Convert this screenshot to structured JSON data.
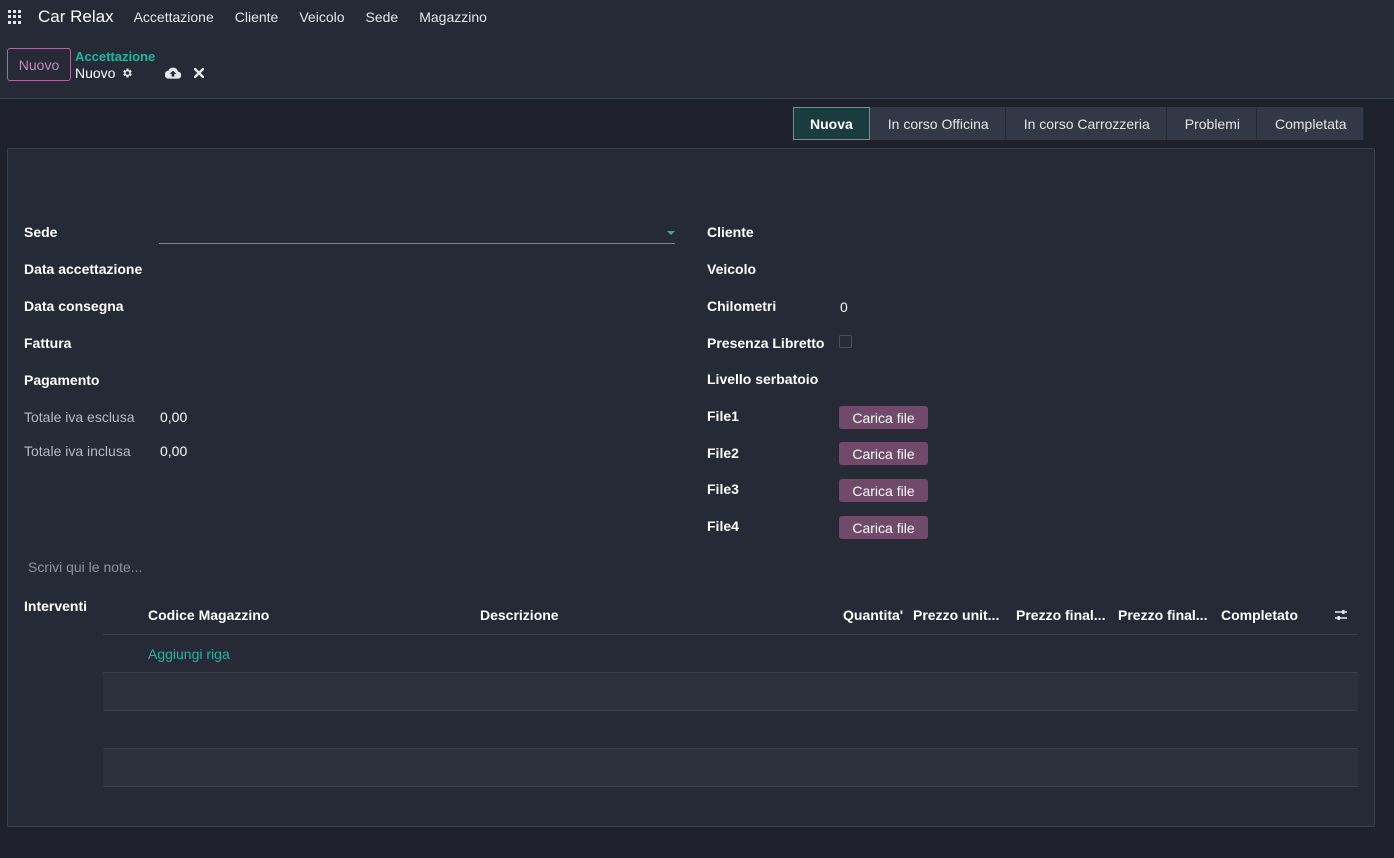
{
  "navbar": {
    "brand": "Car Relax",
    "menu": [
      "Accettazione",
      "Cliente",
      "Veicolo",
      "Sede",
      "Magazzino"
    ]
  },
  "control": {
    "new_button": "Nuovo",
    "breadcrumb_parent": "Accettazione",
    "breadcrumb_current": "Nuovo"
  },
  "statusbar": {
    "stages": [
      "Nuova",
      "In corso Officina",
      "In corso Carrozzeria",
      "Problemi",
      "Completata"
    ],
    "active": "Nuova"
  },
  "form": {
    "left": {
      "sede": "Sede",
      "data_accettazione": "Data accettazione",
      "data_consegna": "Data consegna",
      "fattura": "Fattura",
      "pagamento": "Pagamento",
      "totale_esclusa_label": "Totale iva esclusa",
      "totale_esclusa_value": "0,00",
      "totale_inclusa_label": "Totale iva inclusa",
      "totale_inclusa_value": "0,00"
    },
    "right": {
      "cliente": "Cliente",
      "veicolo": "Veicolo",
      "chilometri_label": "Chilometri",
      "chilometri_value": "0",
      "libretto": "Presenza Libretto",
      "serbatoio": "Livello serbatoio",
      "file1": "File1",
      "file2": "File2",
      "file3": "File3",
      "file4": "File4",
      "upload_label": "Carica file"
    },
    "notes_placeholder": "Scrivi qui le note..."
  },
  "interventi": {
    "label": "Interventi",
    "columns": {
      "codice": "Codice Magazzino",
      "descrizione": "Descrizione",
      "quantita": "Quantita'",
      "prezzo_unit": "Prezzo unit...",
      "prezzo_final1": "Prezzo final...",
      "prezzo_final2": "Prezzo final...",
      "completato": "Completato"
    },
    "add_line": "Aggiungi riga"
  },
  "colors": {
    "background": "#1e212b",
    "panel": "#262a36",
    "accent": "#21b5a0",
    "primary_button": "#71496a"
  }
}
